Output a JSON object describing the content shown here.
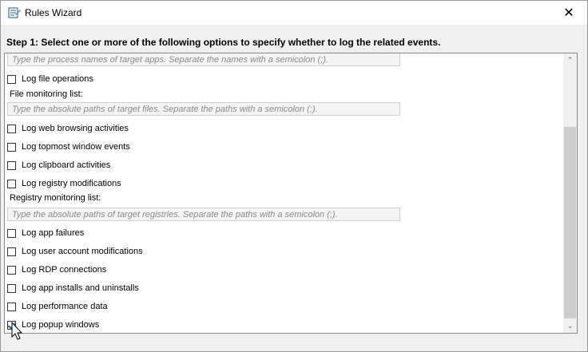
{
  "window": {
    "title": "Rules Wizard",
    "close_glyph": "✕",
    "icon": "rules-wizard-icon"
  },
  "step_header": "Step 1: Select one or more of the following options to specify whether to log the related events.",
  "items": {
    "process_field_placeholder": "Type the process names of target apps. Separate the names with a semicolon (;).",
    "log_file_operations": "Log file operations",
    "file_monitoring_label": "File monitoring list:",
    "file_field_placeholder": "Type the absolute paths of target files. Separate the paths with a semicolon (;).",
    "log_web_browsing": "Log web browsing activities",
    "log_topmost_window": "Log topmost window events",
    "log_clipboard": "Log clipboard activities",
    "log_registry": "Log registry modifications",
    "registry_monitoring_label": "Registry monitoring list:",
    "registry_field_placeholder": "Type the absolute paths of target registries. Separate the paths with a semicolon (;).",
    "log_app_failures": "Log app failures",
    "log_user_account": "Log user account modifications",
    "log_rdp": "Log RDP connections",
    "log_app_installs": "Log app installs and uninstalls",
    "log_performance": "Log performance data",
    "log_popup": "Log popup windows"
  },
  "checked": {
    "log_popup": true
  },
  "scrollbar": {
    "up_glyph": "⌃",
    "down_glyph": "⌄"
  }
}
